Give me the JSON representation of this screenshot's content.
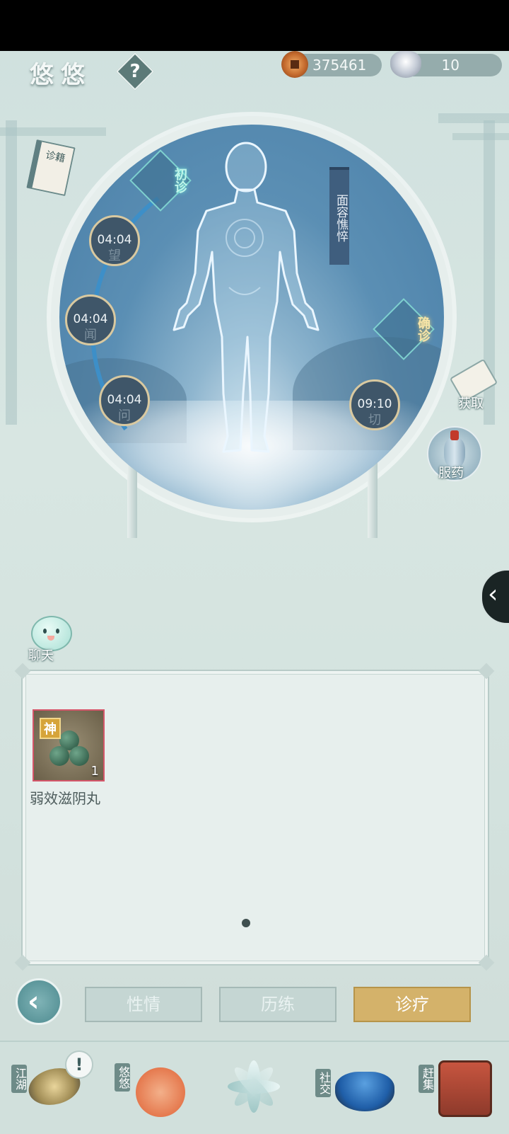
{
  "header": {
    "character_name": "悠悠",
    "help_label": "?",
    "copper_coins": "375461",
    "silver_ingots": "10"
  },
  "diagnosis": {
    "stage_initial": "初诊",
    "stage_confirm": "确诊",
    "banner_text": "面容憔悴",
    "timers": [
      {
        "time": "04:04",
        "char": "望"
      },
      {
        "time": "04:04",
        "char": "闻"
      },
      {
        "time": "04:04",
        "char": "问"
      },
      {
        "time": "09:10",
        "char": "切"
      }
    ],
    "book_label": "诊籍"
  },
  "side_buttons": {
    "obtain_label": "获取",
    "medicine_label": "服药"
  },
  "chat": {
    "label": "聊天"
  },
  "inventory": {
    "items": [
      {
        "name": "弱效滋阴丸",
        "badge": "神",
        "quantity": "1"
      }
    ],
    "current_page": 1,
    "total_pages": 1
  },
  "tabs": [
    {
      "label": "性情",
      "active": false
    },
    {
      "label": "历练",
      "active": false
    },
    {
      "label": "诊疗",
      "active": true
    }
  ],
  "bottom_nav": [
    {
      "label": "江湖"
    },
    {
      "label": "悠悠"
    },
    {
      "label": ""
    },
    {
      "label": "社交"
    },
    {
      "label": "赶集"
    }
  ],
  "alert_icon_text": "!",
  "colors": {
    "active_tab": "#d4b26a",
    "inactive_tab": "#c5d6d3",
    "circle_bg": "#4a7fa8",
    "stage_initial_glow": "#bff6ea",
    "stage_confirm_glow": "#f6e4a8"
  }
}
